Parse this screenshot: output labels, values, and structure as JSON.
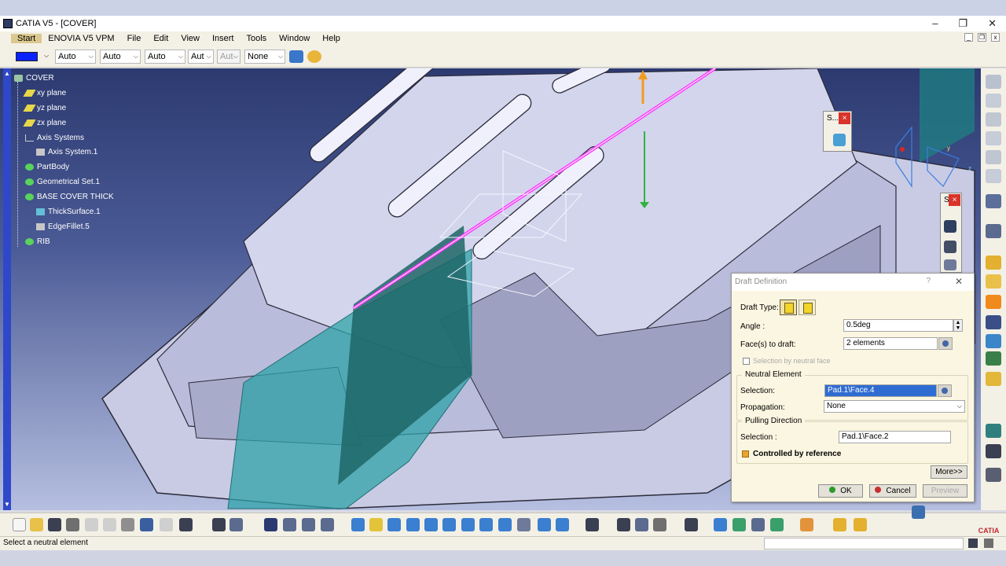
{
  "window": {
    "title": "CATIA V5 - [COVER]",
    "controls": [
      "–",
      "❐",
      "✕"
    ]
  },
  "menu": {
    "items": [
      "Start",
      "ENOVIA V5 VPM",
      "File",
      "Edit",
      "View",
      "Insert",
      "Tools",
      "Window",
      "Help"
    ]
  },
  "toolbar": {
    "combos": [
      "Auto",
      "Auto",
      "Auto",
      "Aut",
      "Aut",
      "None"
    ],
    "color": "#0a22ff"
  },
  "tree": {
    "nodes": [
      {
        "label": "COVER",
        "icon": "part-icon"
      },
      {
        "label": "xy plane",
        "icon": "plane-icon"
      },
      {
        "label": "yz plane",
        "icon": "plane-icon"
      },
      {
        "label": "zx plane",
        "icon": "plane-icon"
      },
      {
        "label": "Axis Systems",
        "icon": "folder-icon"
      },
      {
        "label": "Axis System.1",
        "icon": "axis-system-icon"
      },
      {
        "label": "PartBody",
        "icon": "body-icon"
      },
      {
        "label": "Geometrical Set.1",
        "icon": "geometrical-set-icon"
      },
      {
        "label": "BASE COVER THICK",
        "icon": "geometrical-set-icon"
      },
      {
        "label": "ThickSurface.1",
        "icon": "thick-surface-icon"
      },
      {
        "label": "EdgeFillet.5",
        "icon": "edge-fillet-icon"
      },
      {
        "label": "RIB",
        "icon": "geometrical-set-icon"
      }
    ]
  },
  "mini_dialogs": [
    {
      "label": "S..."
    },
    {
      "label": "S"
    }
  ],
  "dialog": {
    "title": "Draft Definition",
    "help": "?",
    "draft_type_label": "Draft Type:",
    "angle_label": "Angle :",
    "angle_value": "0.5deg",
    "faces_label": "Face(s) to draft:",
    "faces_value": "2 elements",
    "selection_by_neutral": "Selection by neutral face",
    "neutral_group": "Neutral Element",
    "neutral_selection_label": "Selection:",
    "neutral_selection_value": "Pad.1\\Face.4",
    "propagation_label": "Propagation:",
    "propagation_value": "None",
    "pulling_group": "Pulling Direction",
    "pulling_selection_label": "Selection :",
    "pulling_selection_value": "Pad.1\\Face.2",
    "controlled_label": "Controlled by reference",
    "more_button": "More>>",
    "ok_button": "OK",
    "cancel_button": "Cancel",
    "preview_button": "Preview"
  },
  "status": {
    "message": "Select a neutral element"
  },
  "brand": {
    "logo_text": "CATIA"
  }
}
